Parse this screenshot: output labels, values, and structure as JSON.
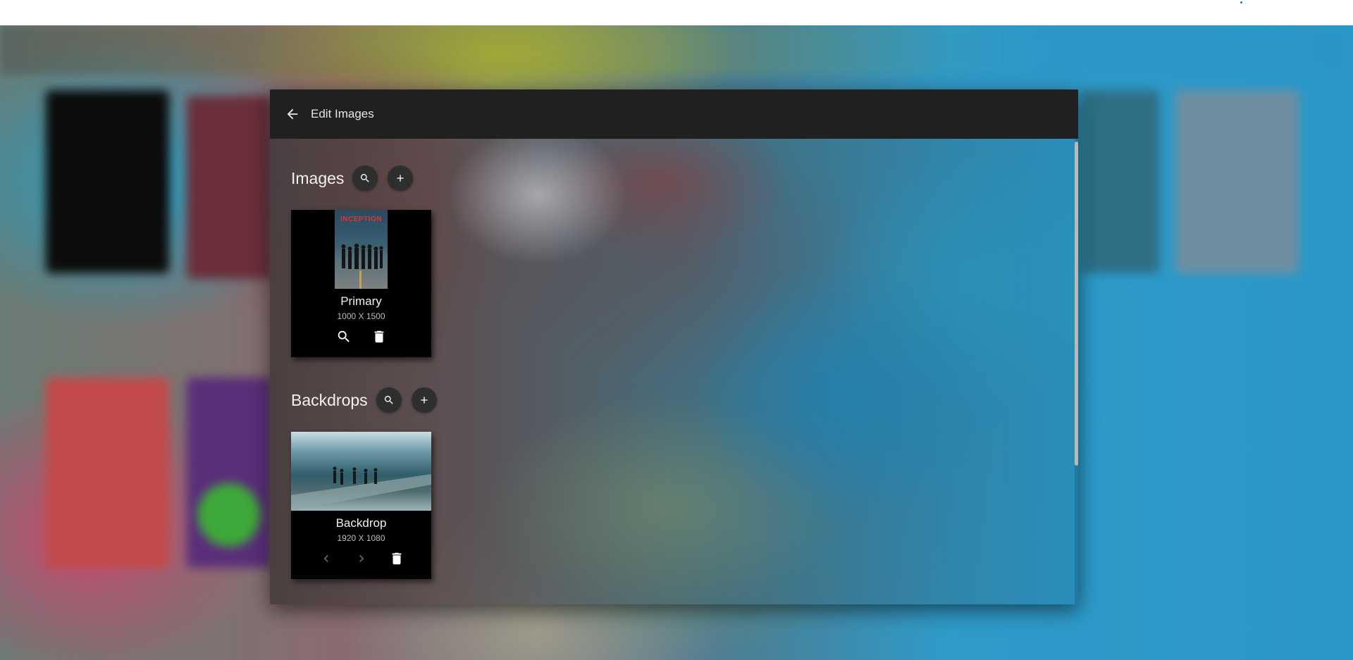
{
  "dialog": {
    "title": "Edit Images"
  },
  "sections": {
    "images": {
      "title": "Images",
      "card": {
        "name": "Primary",
        "dims": "1000 X 1500",
        "poster_title": "INCEPTION"
      }
    },
    "backdrops": {
      "title": "Backdrops",
      "card": {
        "name": "Backdrop",
        "dims": "1920 X 1080"
      }
    }
  },
  "colors": {
    "header_bg": "#202020",
    "button_bg": "#2e2e2e",
    "card_bg": "#000000"
  },
  "icons": [
    "arrow-back-icon",
    "search-icon",
    "plus-icon",
    "trash-icon",
    "chevron-left-icon",
    "chevron-right-icon"
  ]
}
